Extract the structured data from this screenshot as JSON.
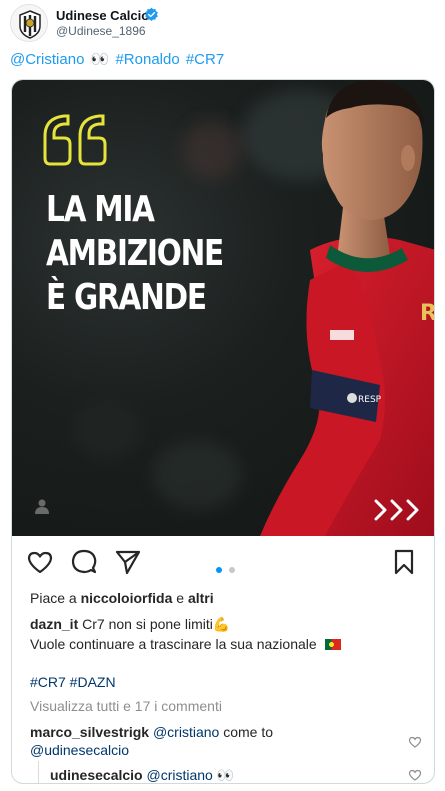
{
  "author": {
    "name": "Udinese Calcio",
    "handle": "@Udinese_1896",
    "verified": true
  },
  "tweet": {
    "mention": "@Cristiano",
    "eyes": "👀",
    "tag_ronaldo": "#Ronaldo",
    "tag_cr7": "#CR7"
  },
  "instagram": {
    "image_headline": [
      "LA MIA",
      "AMBIZIONE",
      "È GRANDE"
    ],
    "likes_prefix": "Piace a",
    "likes_user": "niccoloiorfida",
    "likes_conj": "e",
    "likes_others": "altri",
    "caption_user": "dazn_it",
    "caption_line1": "Cr7 non si pone limiti",
    "caption_emoji1": "💪",
    "caption_line2": "Vuole continuare a trascinare la sua nazionale",
    "hashtags": "#CR7 #DAZN",
    "view_all": "Visualizza tutti e 17 i commenti",
    "comment1_user": "marco_silvestrigk",
    "comment1_mention": "@cristiano",
    "comment1_text": "come to",
    "comment1_mention2": "@udinesecalcio",
    "comment2_user": "udinesecalcio",
    "comment2_mention": "@cristiano",
    "comment2_emoji": "👀",
    "carousel": {
      "total": 2,
      "active": 1
    }
  },
  "colors": {
    "twitter_blue": "#1d9bf0",
    "quote_yellow": "#e6e33b",
    "portugal_red": "#c8102e"
  }
}
